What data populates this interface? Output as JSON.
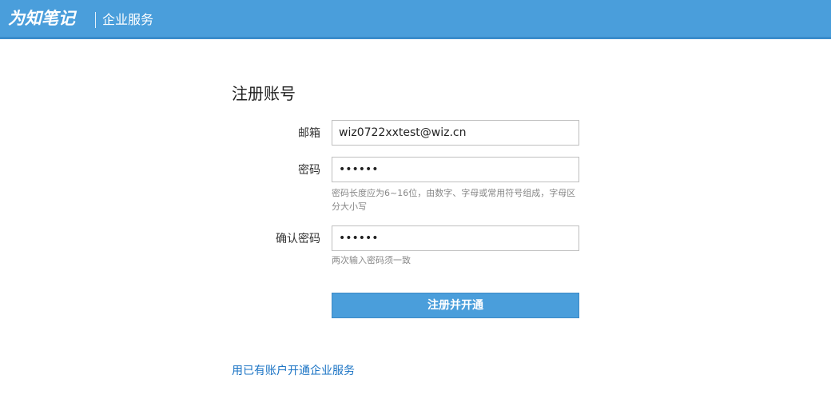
{
  "header": {
    "brand": "为知笔记",
    "section": "企业服务"
  },
  "form": {
    "title": "注册账号",
    "email": {
      "label": "邮箱",
      "value": "wiz0722xxtest@wiz.cn"
    },
    "password": {
      "label": "密码",
      "value": "••••••",
      "hint": "密码长度应为6~16位，由数字、字母或常用符号组成，字母区分大小写"
    },
    "confirm_password": {
      "label": "确认密码",
      "value": "••••••",
      "hint": "两次输入密码须一致"
    },
    "submit_label": "注册并开通"
  },
  "footer": {
    "existing_account_link": "用已有账户开通企业服务"
  },
  "colors": {
    "accent": "#4a9edb",
    "link": "#1a73c4"
  }
}
